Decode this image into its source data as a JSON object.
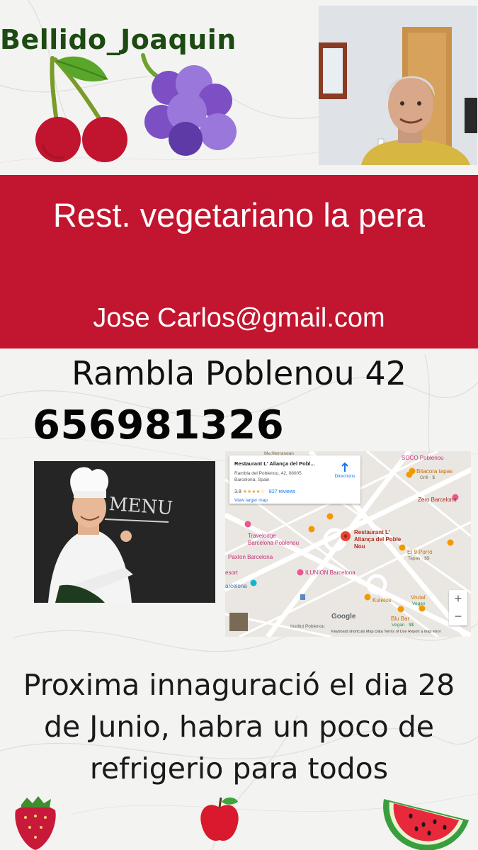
{
  "author": "Bellido_Joaquin",
  "banner": {
    "title": "Rest. vegetariano la pera",
    "email": "Jose Carlos@gmail.com"
  },
  "address": "Rambla Poblenou 42",
  "phone": "656981326",
  "chef_image": {
    "board_text": "MENU"
  },
  "map": {
    "card": {
      "title": "Restaurant L' Aliança del Pobl...",
      "address": "Rambla del Poblenou, 42, 08005 Barcelona, Spain",
      "rating": "3.8",
      "stars": "★★★★☆",
      "reviews": "827 reviews",
      "larger_map": "View larger map",
      "directions": "Directions"
    },
    "places": {
      "soco": "SOCO Poblenou",
      "bitacora": "Bitacora tapas",
      "bitacora_sub": "Grill · $",
      "zero": "Zero Barcelona",
      "travelodge": "Travelodge Barcelona Poblenou",
      "restaurant": "Restaurant L' Aliança del Poble Nou",
      "el9": "El 9 Porró",
      "el9_sub": "Tapas · $$",
      "paxton": "Paxton Barcelona",
      "ilunion": "ILUNION Barcelona",
      "kuletos": "Kuletos",
      "vrutal": "Vrutal",
      "vrutal_sub": "Vegan",
      "bluebar": "Blu Bar",
      "bluebar_sub": "Vegan · $$",
      "institut": "Institut Poblenou",
      "mediterranean": "Mediterranean",
      "resort": "esort",
      "barcelona": "arcelona",
      "google": "Google"
    },
    "zoom_in": "+",
    "zoom_out": "−",
    "footer": "Keyboard shortcuts   Map Data   Terms of Use   Report a map error"
  },
  "promo": {
    "line1": "Proxima innaguració el dia 28",
    "line2": "de Junio,   habra un poco de",
    "line3": "refrigerio para todos"
  },
  "colors": {
    "banner": "#c2152f",
    "author": "#1d4a12",
    "banner_text": "#ffffff"
  }
}
